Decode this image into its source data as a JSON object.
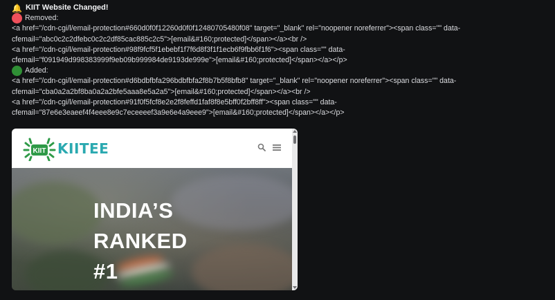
{
  "message": {
    "title": "KIIT Website Changed!",
    "removed_label": "Removed:",
    "added_label": "Added:",
    "removed_lines": [
      "<a href=\"/cdn-cgi/l/email-protection#660d0f0f12260d0f0f12480705480f08\" target=\"_blank\" rel=\"noopener noreferrer\"><span class=\"\" data-",
      "cfemail=\"abc0c2c2dfebc0c2c2df85cac885c2c5\">[email&#160;protected]</span></a><br />",
      "<a href=\"/cdn-cgi/l/email-protection#98f9fcf5f1ebebf1f7f6d8f3f1f1ecb6f9fbb6f1f6\"><span class=\"\" data-",
      "cfemail=\"f091949d998383999f9eb09b999984de9193de999e\">[email&#160;protected]</span></a></p>"
    ],
    "added_lines": [
      "<a href=\"/cdn-cgi/l/email-protection#d6bdbfbfa296bdbfbfa2f8b7b5f8bfb8\" target=\"_blank\" rel=\"noopener noreferrer\"><span class=\"\" data-",
      "cfemail=\"cba0a2a2bf8ba0a2a2bfe5aaa8e5a2a5\">[email&#160;protected]</span></a><br />",
      "<a href=\"/cdn-cgi/l/email-protection#91f0f5fcf8e2e2f8feffd1faf8f8e5bff0f2bff8ff\"><span class=\"\" data-",
      "cfemail=\"87e6e3eaeef4f4eee8e9c7eceeeef3a9e6e4a9eee9\">[email&#160;protected]</span></a></p>"
    ]
  },
  "embed": {
    "logo_text": "KIITEE",
    "logo_badge": "KIIT",
    "hero_lines": [
      "INDIA’S",
      "RANKED",
      "#1"
    ],
    "colors": {
      "logo_green": "#2e9a47",
      "logo_teal": "#2aa9b0",
      "removed_dot": "#f0505b",
      "added_dot": "#2f8f35"
    },
    "icons": [
      "search-icon",
      "menu-icon"
    ]
  }
}
